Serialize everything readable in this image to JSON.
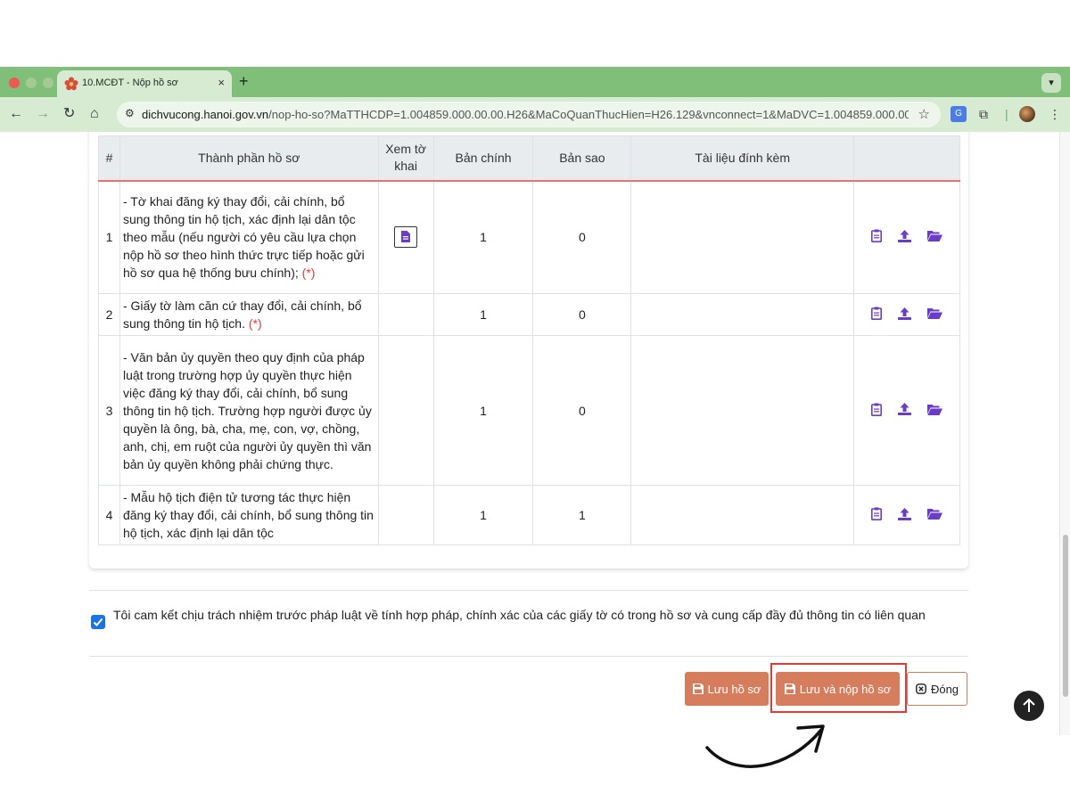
{
  "browser": {
    "tab_title": "10.MCĐT - Nộp hồ sơ",
    "tab_close": "×",
    "new_tab": "+",
    "url_host": "dichvucong.hanoi.gov.vn",
    "url_path": "/nop-ho-so?MaTTHCDP=1.004859.000.00.00.H26&MaCoQuanThucHien=H26.129&vnconnect=1&MaDVC=1.004859.000.00.00...."
  },
  "table": {
    "headers": {
      "num": "#",
      "name": "Thành phần hồ sơ",
      "view": "Xem tờ khai",
      "main": "Bản chính",
      "copy": "Bản sao",
      "attach": "Tài liệu đính kèm"
    },
    "required_mark": "(*)",
    "rows": [
      {
        "num": "1",
        "name": "- Tờ khai đăng ký thay đổi, cải chính, bổ sung thông tin hộ tịch, xác định lại dân tộc theo mẫu (nếu người có yêu cầu lựa chọn nộp hồ sơ theo hình thức trực tiếp hoặc gửi hồ sơ qua hệ thống bưu chính);",
        "main": "1",
        "copy": "0"
      },
      {
        "num": "2",
        "name": "- Giấy tờ làm căn cứ thay đổi, cải chính, bổ sung thông tin hộ tịch.",
        "main": "1",
        "copy": "0"
      },
      {
        "num": "3",
        "name": "- Văn bản ủy quyền theo quy định của pháp luật trong trường hợp ủy quyền thực hiện việc đăng ký thay đổi, cải chính, bổ sung thông tin hộ tịch. Trường hợp người được ủy quyền là ông, bà, cha, mẹ, con, vợ, chồng, anh, chị, em ruột của người ủy quyền thì văn bản ủy quyền không phải chứng thực.",
        "main": "1",
        "copy": "0"
      },
      {
        "num": "4",
        "name": "- Mẫu hộ tịch điện tử tương tác thực hiện đăng ký thay đổi, cải chính, bổ sung thông tin hộ tịch, xác định lại dân tộc",
        "main": "1",
        "copy": "1"
      }
    ]
  },
  "commitment": {
    "checked": true,
    "text": "Tôi cam kết chịu trách nhiệm trước pháp luật về tính hợp pháp, chính xác của các giấy tờ có trong hồ sơ và cung cấp đầy đủ thông tin có liên quan"
  },
  "buttons": {
    "save": "Lưu hồ sơ",
    "save_submit": "Lưu và nộp hồ sơ",
    "close": "Đóng"
  },
  "colors": {
    "accent_button": "#d67d5e",
    "action_icon": "#6a3cc7",
    "highlight": "#e53935",
    "browser_frame": "#7fbf7a"
  }
}
